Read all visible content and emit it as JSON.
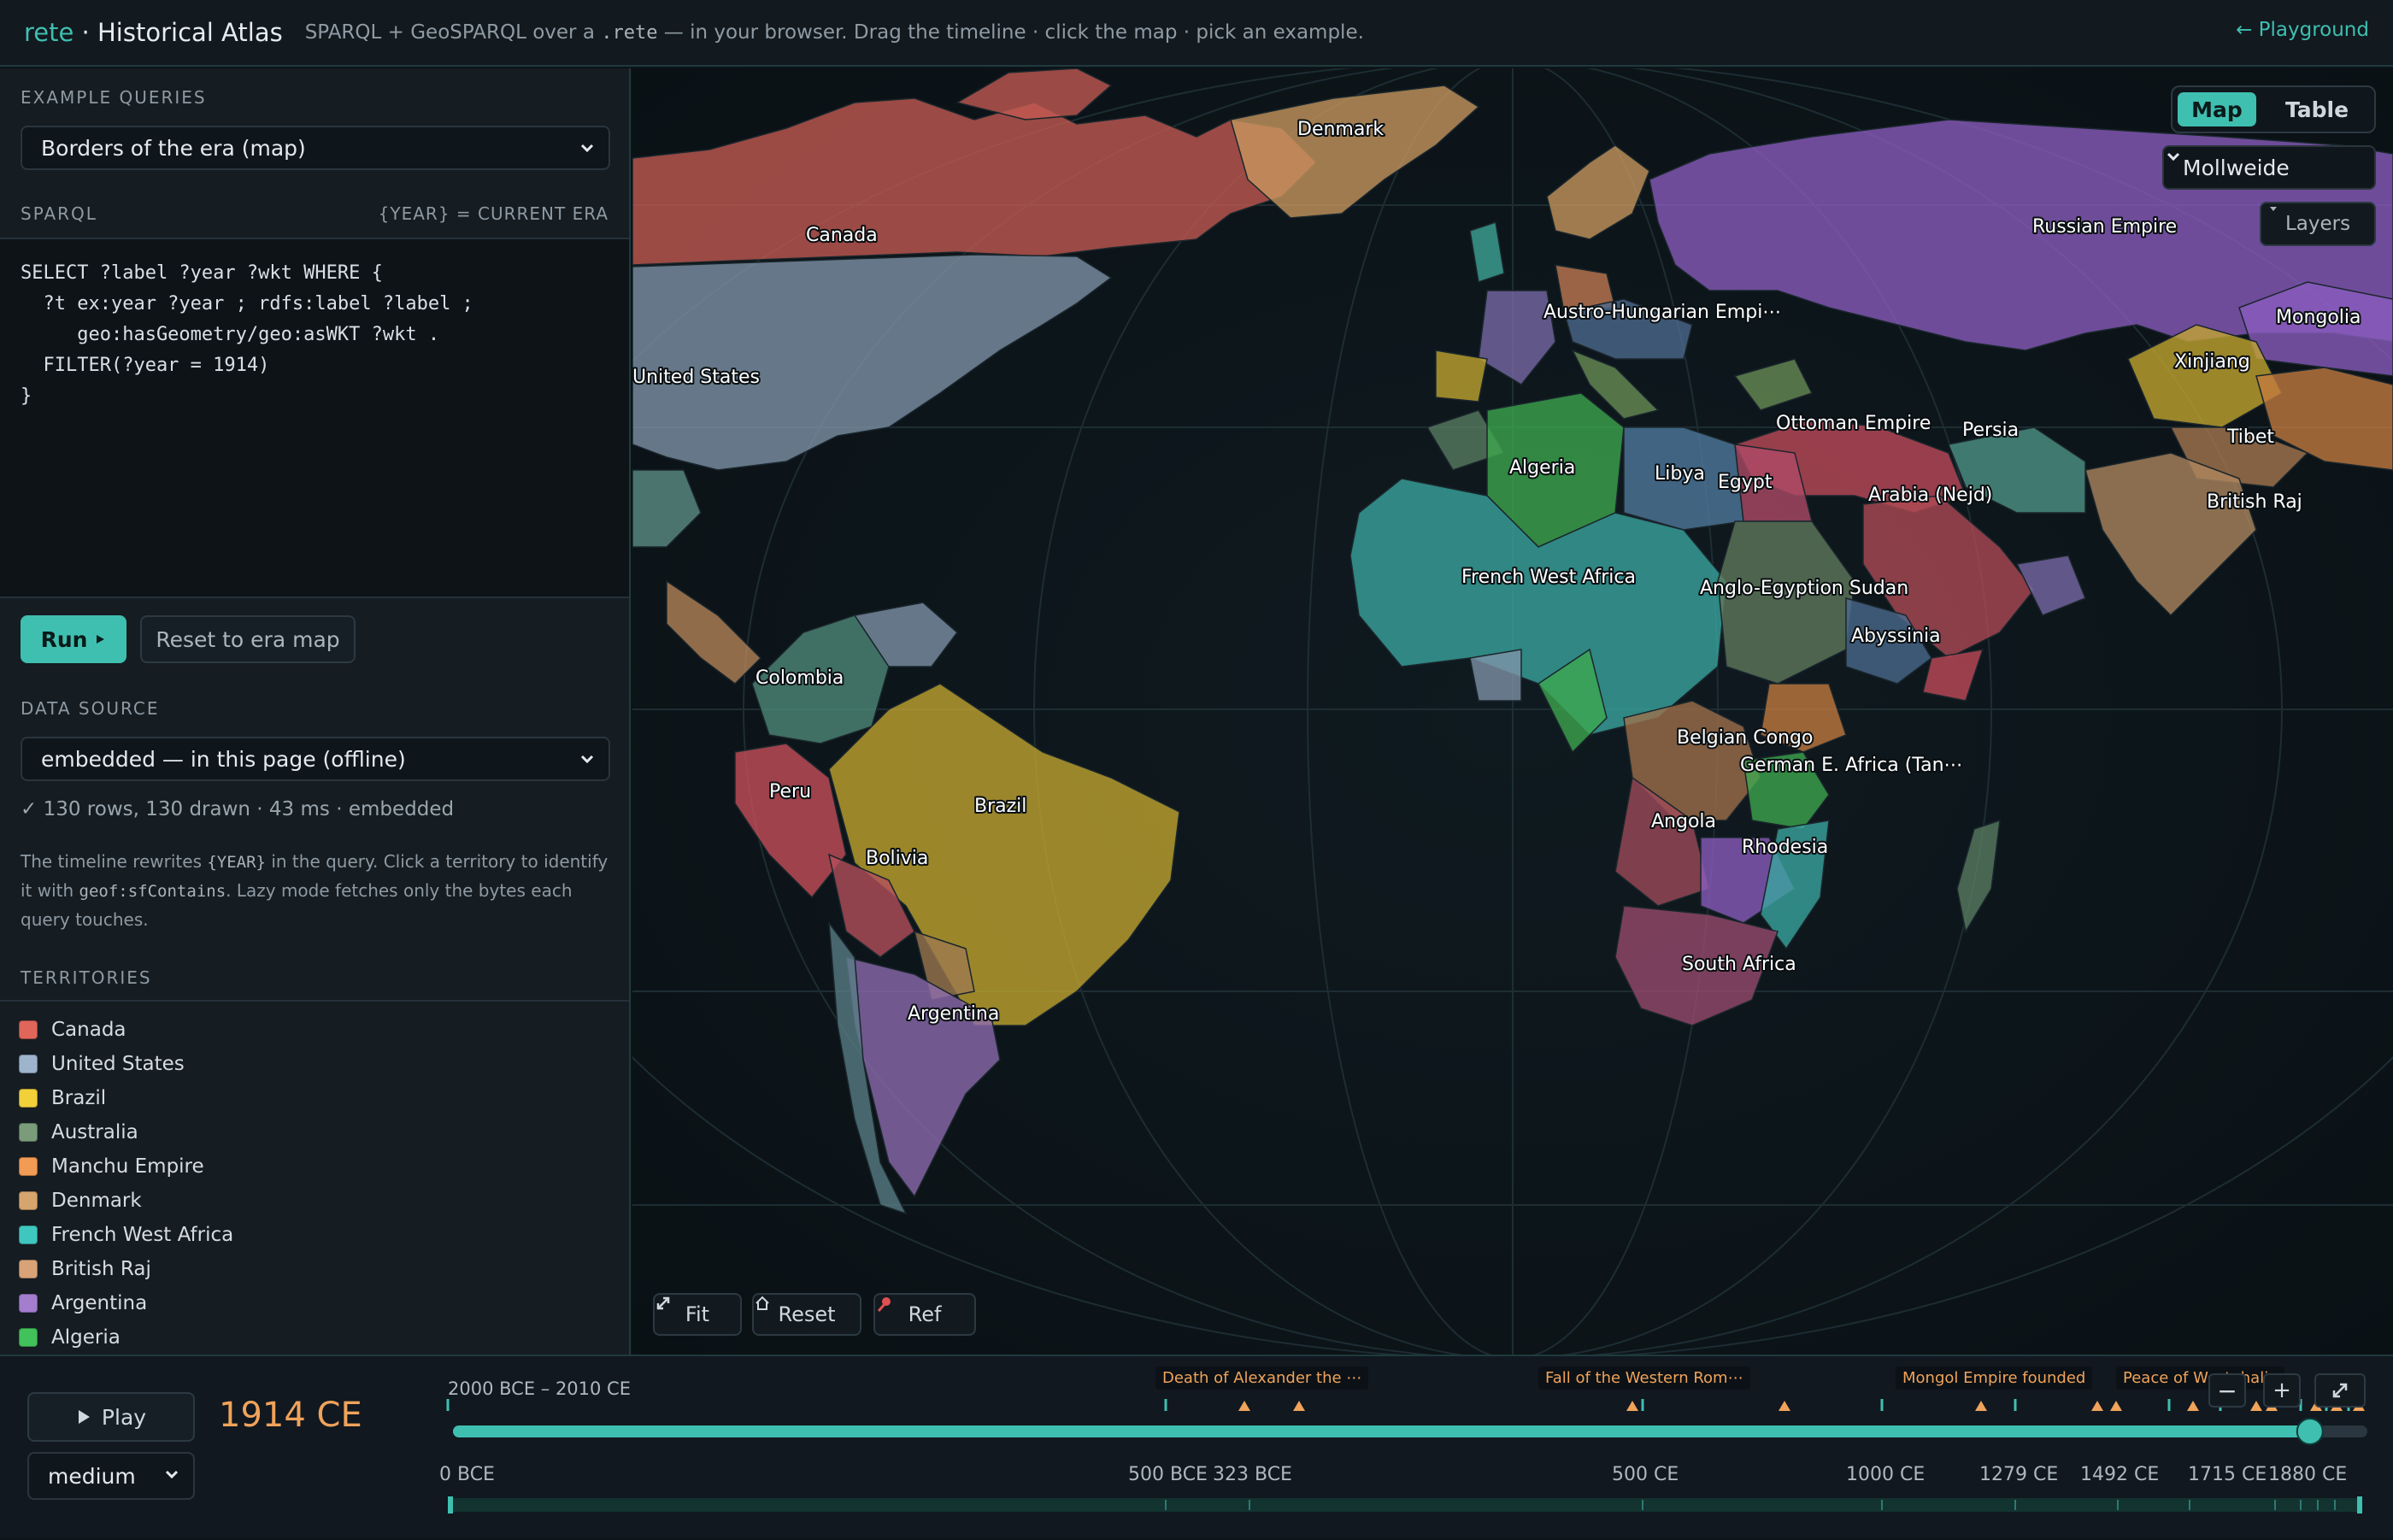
{
  "header": {
    "brand": "rete",
    "brand_sep": " · ",
    "title": "Historical Atlas",
    "subtitle_pre": "SPARQL + GeoSPARQL over a ",
    "subtitle_code": ".rete",
    "subtitle_post": " — in your browser. Drag the timeline · click the map · pick an example.",
    "playground_link": "← Playground"
  },
  "sidebar": {
    "examples_label": "EXAMPLE QUERIES",
    "example_selected": "Borders of the era (map)",
    "sparql_label": "SPARQL",
    "sparql_hint": "{YEAR} = CURRENT ERA",
    "query_lines": [
      "SELECT ?label ?year ?wkt WHERE {",
      "  ?t ex:year ?year ; rdfs:label ?label ;",
      "     geo:hasGeometry/geo:asWKT ?wkt .",
      "  FILTER(?year = 1914)",
      "}"
    ],
    "run_label": "Run",
    "run_icon": "play-triangle-icon",
    "reset_label": "Reset to era map",
    "data_source_label": "DATA SOURCE",
    "data_source_selected": "embedded — in this page (offline)",
    "status": "✓ 130 rows, 130 drawn · 43 ms · embedded",
    "help_1": "The timeline rewrites ",
    "help_code_1": "{YEAR}",
    "help_2": " in the query. Click a territory to identify it with ",
    "help_code_2": "geof:sfContains",
    "help_3": ". Lazy mode fetches only the bytes each query touches.",
    "territories_label": "TERRITORIES",
    "territories": [
      {
        "name": "Canada",
        "color": "#e0665a"
      },
      {
        "name": "United States",
        "color": "#9db4cc"
      },
      {
        "name": "Brazil",
        "color": "#f2d03a"
      },
      {
        "name": "Australia",
        "color": "#7a9c7a"
      },
      {
        "name": "Manchu Empire",
        "color": "#f29b54"
      },
      {
        "name": "Denmark",
        "color": "#d6a56e"
      },
      {
        "name": "French West Africa",
        "color": "#3fc7bf"
      },
      {
        "name": "British Raj",
        "color": "#d9a377"
      },
      {
        "name": "Argentina",
        "color": "#a57dcf"
      },
      {
        "name": "Algeria",
        "color": "#42c25a"
      }
    ]
  },
  "map": {
    "view_tabs": [
      "Map",
      "Table"
    ],
    "active_tab": "Map",
    "projection": "Mollweide",
    "layers_label": "Layers",
    "fit_label": "Fit",
    "reset_label": "Reset",
    "ref_label": "Ref",
    "labels": [
      "Denmark",
      "Canada",
      "Russian Empire",
      "Mongolia",
      "Austro-Hungarian Empi⋯",
      "Xinjiang",
      "United States",
      "Ottoman Empire",
      "Persia",
      "Tibet",
      "Algeria",
      "Libya",
      "Egypt",
      "Arabia (Nejd)",
      "British Raj",
      "French West Africa",
      "Anglo-Egyption Sudan",
      "Abyssinia",
      "Colombia",
      "Belgian Congo",
      "German E. Africa (Tan⋯",
      "Peru",
      "Brazil",
      "Angola",
      "Rhodesia",
      "Bolivia",
      "South Africa",
      "Argentina"
    ]
  },
  "timeline": {
    "play_label": "Play",
    "current_year": "1914 CE",
    "speed_selected": "medium",
    "range_label": "2000 BCE – 2010 CE",
    "events": [
      "Death of Alexander the ⋯",
      "Fall of the Western Rom⋯",
      "Mongol Empire founded",
      "Peace of Westphalia"
    ],
    "axis_labels": [
      "0 BCE",
      "500 BCE",
      "323 BCE",
      "500 CE",
      "1000 CE",
      "1279 CE",
      "1492 CE",
      "1715 CE",
      "1880 CE"
    ],
    "position_fraction": 0.97,
    "accent": "#3fbfb0",
    "event_color": "#f0a35a"
  }
}
